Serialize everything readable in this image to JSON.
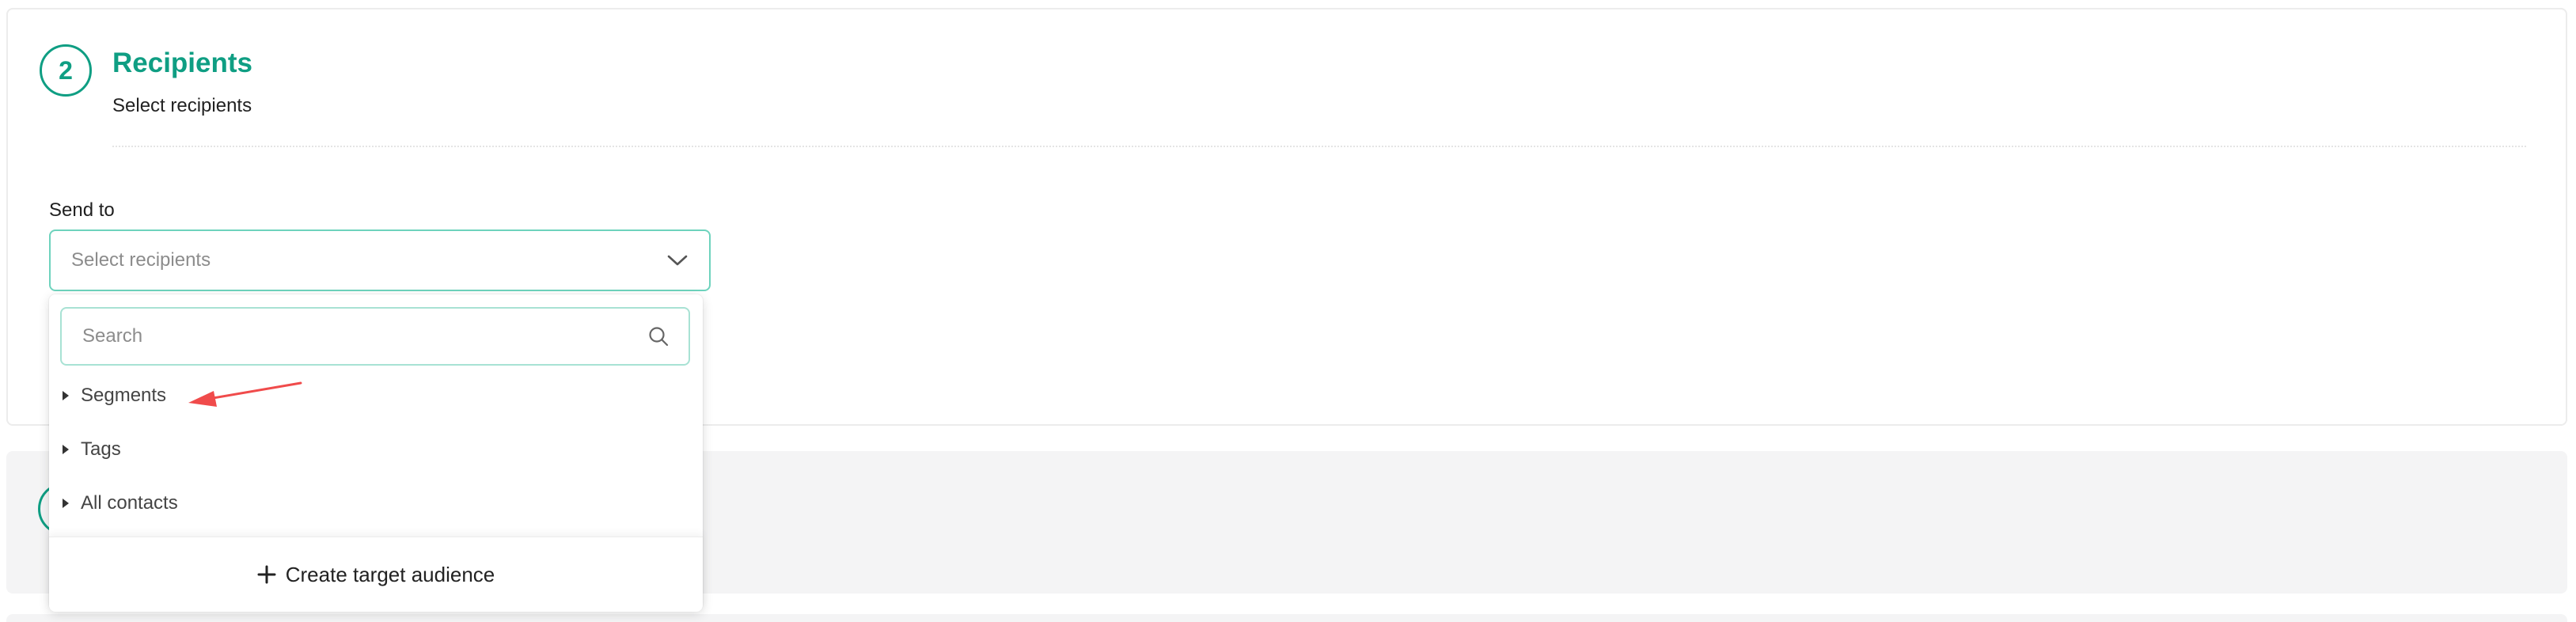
{
  "step": {
    "number": "2",
    "title": "Recipients",
    "subtitle": "Select recipients"
  },
  "send_to": {
    "label": "Send to",
    "placeholder": "Select recipients"
  },
  "dropdown": {
    "search_placeholder": "Search",
    "items": [
      {
        "label": "Segments"
      },
      {
        "label": "Tags"
      },
      {
        "label": "All contacts"
      }
    ],
    "create_label": "Create target audience"
  },
  "colors": {
    "accent": "#0f9e83",
    "border_active": "#6ed3bd",
    "annotation": "#f04b4b"
  },
  "icons": {
    "select": "chevron-down-icon",
    "search": "search-icon",
    "tree_item": "caret-right-icon",
    "create": "plus-icon"
  }
}
